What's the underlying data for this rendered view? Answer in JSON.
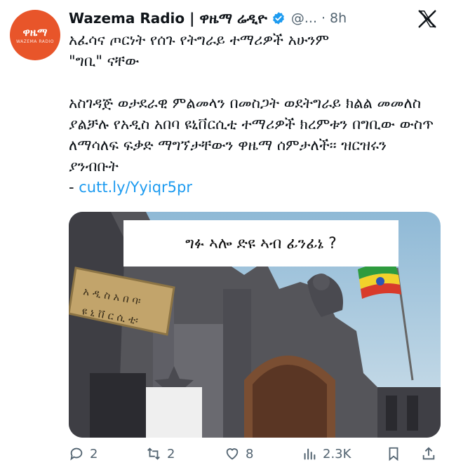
{
  "avatar": {
    "logo_text": "ዋዜማ",
    "subtitle": "WAZEMA RADIO"
  },
  "header": {
    "name": "Wazema Radio | ዋዜማ ሬዲዮ",
    "handle": "@...",
    "time": "8h",
    "verified_icon": "verified-badge-icon",
    "close_icon": "x-logo-icon"
  },
  "tweet": {
    "line1": "አፈሳና ጦርነት የሰጉ የትግራይ ተማሪዎች አሁንም",
    "line2": "\"ግቢ\" ናቸው",
    "para2": "አስገዳጅ ወታደራዊ ምልመላን በመስጋት ወደትግራይ ክልል መመለስ ያልቻሉ የአዲስ አበባ ዩኒቨርሲቲ ተማሪዎች ክረምቱን በግቢው ውስጥ ለማሳለፍ ፍቃድ ማግኘታቸውን ዋዜማ ሰምታለች፡፡ ዝርዝሩን ያንብቡት",
    "link_prefix": "- ",
    "link": "cutt.ly/Yyiqr5pr"
  },
  "media": {
    "overlay_text": "ግፉ ኣሎ ድዩ ኣብ ፊንፊኔ ?",
    "sign_line1": "አ ዲ ስ  አ በ ባ፡",
    "sign_line2": "ዩ ኒ ቨ ር ሲ ቲ፡"
  },
  "actions": {
    "reply": {
      "icon": "reply-icon",
      "count": "2"
    },
    "retweet": {
      "icon": "retweet-icon",
      "count": "2"
    },
    "like": {
      "icon": "heart-icon",
      "count": "8"
    },
    "views": {
      "icon": "views-chart-icon",
      "count": "2.3K"
    },
    "bookmark": {
      "icon": "bookmark-icon"
    },
    "share": {
      "icon": "share-icon"
    }
  },
  "colors": {
    "brand": "#e8552a",
    "link": "#1d9bf0",
    "muted": "#536471",
    "text": "#0f1419"
  }
}
